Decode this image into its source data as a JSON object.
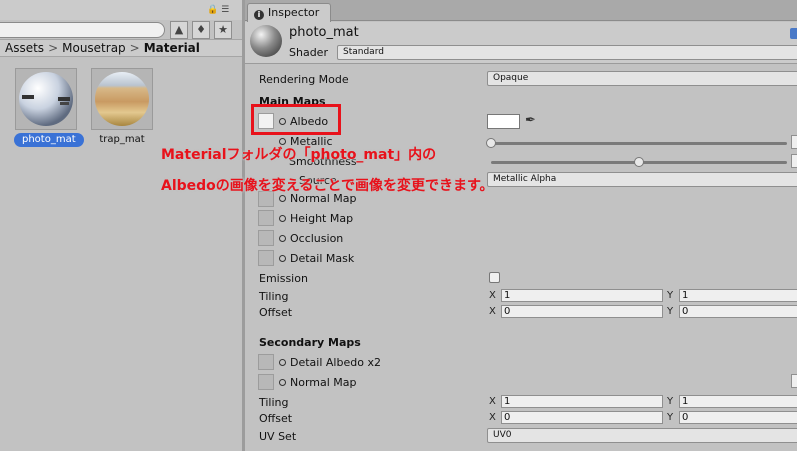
{
  "project": {
    "breadcrumb": [
      "Assets",
      "Mousetrap",
      "Material"
    ],
    "assets": [
      {
        "label": "photo_mat",
        "selected": true
      },
      {
        "label": "trap_mat",
        "selected": false
      }
    ],
    "icons": [
      "lock-icon",
      "menu-icon",
      "filter-by-type-icon",
      "filter-by-label-icon",
      "favorite-star-icon"
    ]
  },
  "inspector": {
    "tab_label": "Inspector",
    "material_name": "photo_mat",
    "shader_label": "Shader",
    "shader_value": "Standard",
    "rendering_mode_label": "Rendering Mode",
    "rendering_mode_value": "Opaque",
    "main_maps_title": "Main Maps",
    "albedo_label": "Albedo",
    "metallic_label": "Metallic",
    "smoothness_label": "Smoothness",
    "source_label": "Source",
    "source_value": "Metallic Alpha",
    "normal_map_label": "Normal Map",
    "height_map_label": "Height Map",
    "occlusion_label": "Occlusion",
    "detail_mask_label": "Detail Mask",
    "emission_label": "Emission",
    "tiling_label": "Tiling",
    "offset_label": "Offset",
    "x_label": "X",
    "y_label": "Y",
    "main_tiling": {
      "x": "1",
      "y": "1"
    },
    "main_offset": {
      "x": "0",
      "y": "0"
    },
    "secondary_maps_title": "Secondary Maps",
    "detail_albedo_label": "Detail Albedo x2",
    "secondary_normal_label": "Normal Map",
    "secondary_tiling": {
      "x": "1",
      "y": "1"
    },
    "secondary_offset": {
      "x": "0",
      "y": "0"
    },
    "uv_set_label": "UV Set",
    "uv_set_value": "UV0",
    "metallic_level": 0.0,
    "smoothness_level": 0.5
  },
  "annotation": {
    "line1": "Materialフォルダの「photo_mat」内の",
    "line2": "Albedoの画像を変えることで画像を変更できます。"
  },
  "colors": {
    "annotation": "#e8121b",
    "selection": "#3a72d6"
  }
}
